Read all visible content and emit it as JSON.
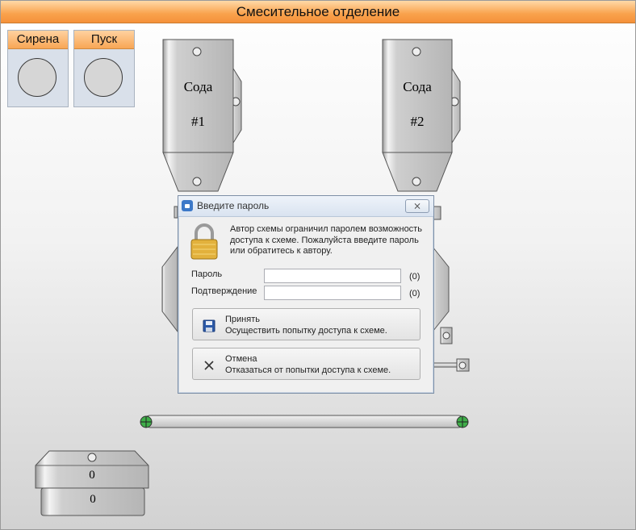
{
  "header": {
    "title": "Смесительное отделение"
  },
  "controls": [
    {
      "label": "Сирена"
    },
    {
      "label": "Пуск"
    }
  ],
  "hoppers": [
    {
      "name": "Сода",
      "number": "#1"
    },
    {
      "name": "Сода",
      "number": "#2"
    }
  ],
  "scale": {
    "value_top": "0",
    "value_bottom": "0"
  },
  "dialog": {
    "title": "Введите пароль",
    "close_symbol": "⨯",
    "message": "Автор схемы ограничил паролем возможность доступа к схеме. Пожалуйста введите пароль или обратитесь к автору.",
    "password_label": "Пароль",
    "password_value": "",
    "password_count": "(0)",
    "confirm_label": "Подтверждение",
    "confirm_value": "",
    "confirm_count": "(0)",
    "accept": {
      "title": "Принять",
      "description": "Осуществить попытку доступа к схеме."
    },
    "cancel": {
      "title": "Отмена",
      "description": "Отказаться от попытки доступа к схеме."
    }
  },
  "colors": {
    "header_orange": "#f9a24c",
    "hopper_fill": "#bdbdbd",
    "conveyor_valve": "#3fae49"
  }
}
